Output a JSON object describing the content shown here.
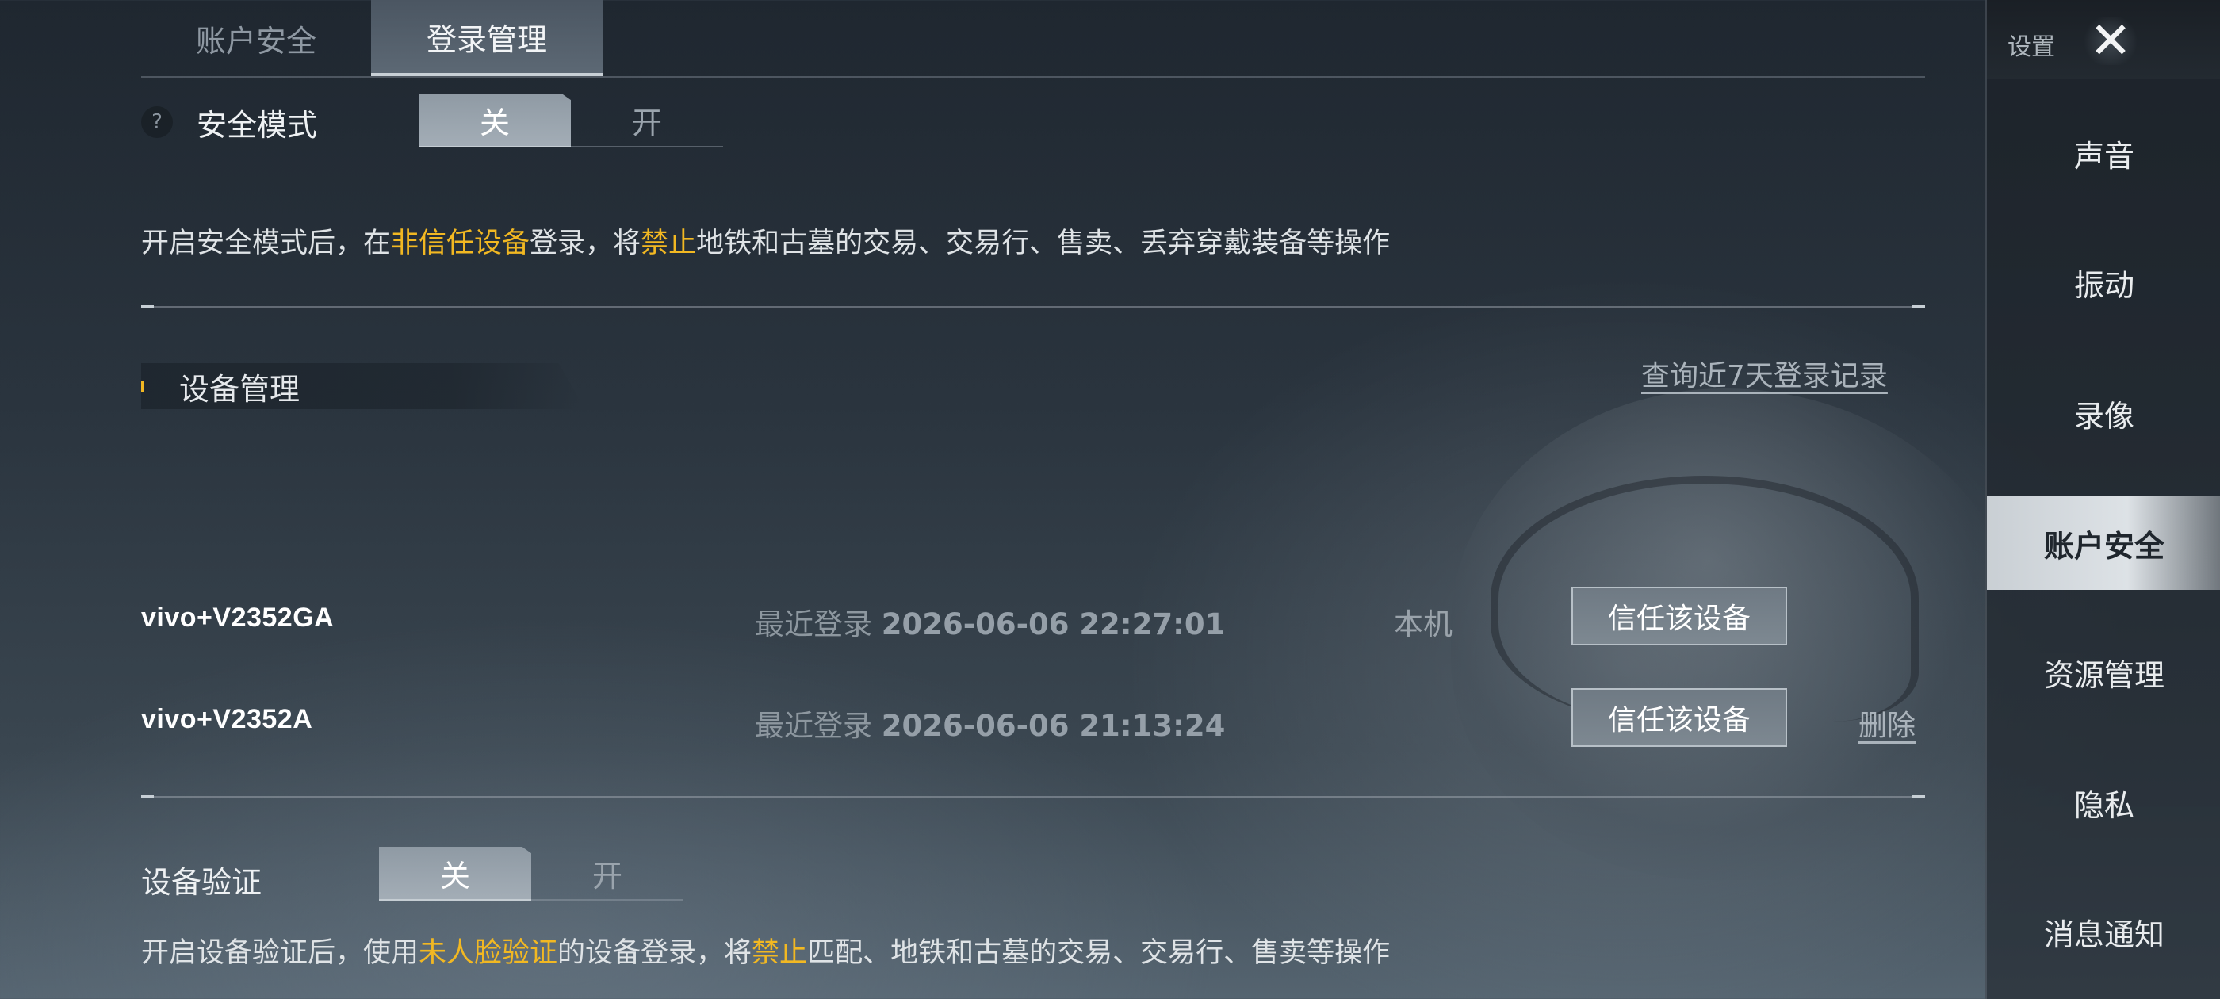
{
  "tabs": [
    {
      "label": "账户安全",
      "active": false
    },
    {
      "label": "登录管理",
      "active": true
    }
  ],
  "safe_mode": {
    "help_icon": "?",
    "label": "安全模式",
    "off_label": "关",
    "on_label": "开",
    "selected": "关",
    "desc_prefix": "开启安全模式后，在",
    "desc_hl1": "非信任设备",
    "desc_mid": "登录，将",
    "desc_hl2": "禁止",
    "desc_suffix": "地铁和古墓的交易、交易行、售卖、丢弃穿戴装备等操作"
  },
  "device_section": {
    "title": "设备管理",
    "history_link": "查询近7天登录记录",
    "devices": [
      {
        "name": "vivo+V2352GA",
        "login_label": "最近登录",
        "login_time": "2026-06-06 22:27:01",
        "tag": "本机",
        "trust_label": "信任该设备"
      },
      {
        "name": "vivo+V2352A",
        "login_label": "最近登录",
        "login_time": "2026-06-06 21:13:24",
        "trust_label": "信任该设备",
        "delete_label": "删除"
      }
    ]
  },
  "device_verify": {
    "label": "设备验证",
    "off_label": "关",
    "on_label": "开",
    "selected": "关",
    "desc_prefix": "开启设备验证后，使用",
    "desc_hl1": "未人脸验证",
    "desc_mid": "的设备登录，将",
    "desc_hl2": "禁止",
    "desc_suffix": "匹配、地铁和古墓的交易、交易行、售卖等操作"
  },
  "sidebar": {
    "title": "设置",
    "close_icon": "close-icon",
    "items": [
      {
        "label": "声音"
      },
      {
        "label": "振动"
      },
      {
        "label": "录像"
      },
      {
        "label": "账户安全",
        "active": true
      },
      {
        "label": "资源管理"
      },
      {
        "label": "隐私"
      },
      {
        "label": "消息通知"
      }
    ]
  },
  "colors": {
    "highlight": "#f2b822",
    "active_side_bg": "#d6dbdf"
  }
}
